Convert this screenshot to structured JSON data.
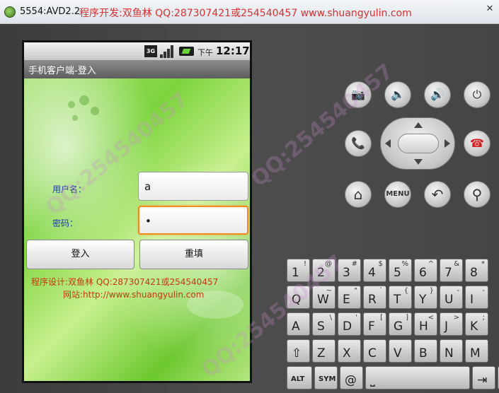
{
  "window": {
    "title": "5554:AVD2.2",
    "banner": "程序开发:双鱼林 QQ:287307421或254540457 www.shuangyulin.com",
    "close_glyph": "✕"
  },
  "statusbar": {
    "network": "3G",
    "ampm": "下午",
    "time": "12:17"
  },
  "app": {
    "title": "手机客户端-登入"
  },
  "form": {
    "username_label": "用户名：",
    "username_value": "a",
    "password_label": "密码：",
    "password_value": "•",
    "login_button": "登入",
    "reset_button": "重填"
  },
  "info": {
    "line1": "程序设计:双鱼林    QQ:287307421或254540457",
    "line2": "网站:http://www.shuangyulin.com"
  },
  "controls": {
    "menu_label": "MENU",
    "camera_icon": "📷",
    "vol_down_icon": "🔈",
    "vol_up_icon": "🔊",
    "power_icon": "⏻",
    "call_icon": "📞",
    "end_call_icon": "☎",
    "home_icon": "⌂",
    "back_icon": "↶",
    "search_icon": "⚲"
  },
  "keyboard": {
    "row1": [
      {
        "main": "1",
        "alt": "!"
      },
      {
        "main": "2",
        "alt": "@"
      },
      {
        "main": "3",
        "alt": "#"
      },
      {
        "main": "4",
        "alt": "$"
      },
      {
        "main": "5",
        "alt": "%"
      },
      {
        "main": "6",
        "alt": "^"
      },
      {
        "main": "7",
        "alt": "&"
      },
      {
        "main": "8",
        "alt": "*"
      }
    ],
    "row2": [
      {
        "main": "Q",
        "alt": ""
      },
      {
        "main": "W",
        "alt": "~"
      },
      {
        "main": "E",
        "alt": "\""
      },
      {
        "main": "R",
        "alt": "`"
      },
      {
        "main": "T",
        "alt": "{"
      },
      {
        "main": "Y",
        "alt": "}"
      },
      {
        "main": "U",
        "alt": "-"
      },
      {
        "main": "I",
        "alt": "-"
      }
    ],
    "row3": [
      {
        "main": "A",
        "alt": ""
      },
      {
        "main": "S",
        "alt": "\\"
      },
      {
        "main": "D",
        "alt": "'"
      },
      {
        "main": "F",
        "alt": "["
      },
      {
        "main": "G",
        "alt": "]"
      },
      {
        "main": "H",
        "alt": "<"
      },
      {
        "main": "J",
        "alt": ">"
      },
      {
        "main": "K",
        "alt": ";"
      }
    ],
    "row4": [
      {
        "main": "⇧",
        "alt": ""
      },
      {
        "main": "Z",
        "alt": ""
      },
      {
        "main": "X",
        "alt": ""
      },
      {
        "main": "C",
        "alt": ""
      },
      {
        "main": "V",
        "alt": ""
      },
      {
        "main": "B",
        "alt": ""
      },
      {
        "main": "N",
        "alt": ""
      },
      {
        "main": "M",
        "alt": ""
      }
    ],
    "row5": [
      {
        "main": "ALT",
        "alt": ""
      },
      {
        "main": "SYM",
        "alt": ""
      },
      {
        "main": "@",
        "alt": ""
      },
      {
        "main": "⎵",
        "alt": ""
      },
      {
        "main": "⇥",
        "alt": ""
      },
      {
        "main": "/",
        "alt": "?"
      }
    ]
  },
  "watermark": "QQ:254540457"
}
